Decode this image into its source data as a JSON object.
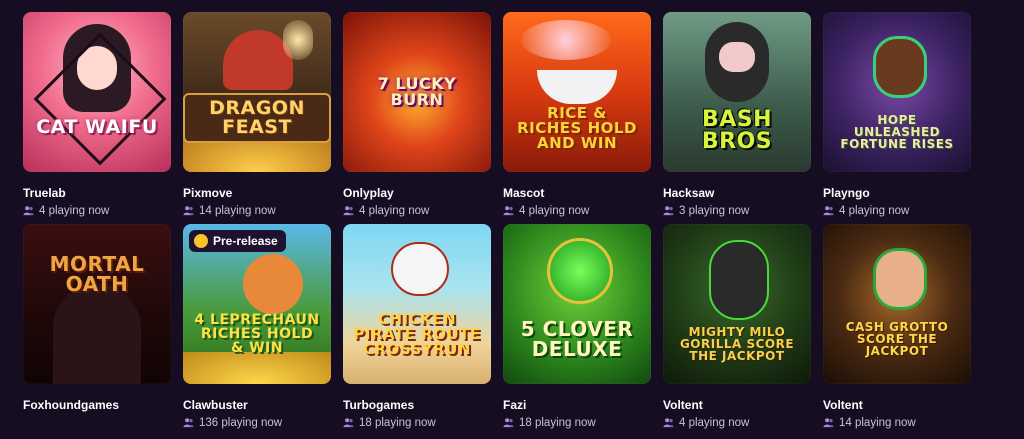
{
  "games": [
    {
      "title_art": "CAT WAIFU",
      "provider": "Truelab",
      "playing": "4 playing now"
    },
    {
      "title_art": "DRAGON FEAST",
      "provider": "Pixmove",
      "playing": "14 playing now"
    },
    {
      "title_art": "7 Lucky BURN",
      "provider": "Onlyplay",
      "playing": "4 playing now"
    },
    {
      "title_art": "RICE & RICHES Hold and Win",
      "provider": "Mascot",
      "playing": "4 playing now"
    },
    {
      "title_art": "BASH BROS",
      "provider": "Hacksaw",
      "playing": "3 playing now"
    },
    {
      "title_art": "HOPE UNLEASHED FORTUNE RISES",
      "provider": "Playngo",
      "playing": "4 playing now"
    },
    {
      "title_art": "MORTAL OATH",
      "provider": "Foxhoundgames",
      "playing": ""
    },
    {
      "title_art": "4 LEPRECHAUN RICHES HOLD & WIN",
      "provider": "Clawbuster",
      "playing": "136 playing now",
      "badge": "Pre-release"
    },
    {
      "title_art": "CHICKEN PIRATE ROUTE CROSSYRUN",
      "provider": "Turbogames",
      "playing": "18 playing now"
    },
    {
      "title_art": "5 CLOVER DELUXE",
      "provider": "Fazi",
      "playing": "18 playing now"
    },
    {
      "title_art": "MIGHTY MILO GORILLA SCORE THE JACKPOT",
      "provider": "Voltent",
      "playing": "4 playing now"
    },
    {
      "title_art": "CASH GROTTO SCORE THE JACKPOT",
      "provider": "Voltent",
      "playing": "14 playing now"
    }
  ],
  "icons": {
    "players": "users-icon",
    "badge": "lightning-bolt-icon"
  },
  "colors": {
    "background": "#170d22",
    "subtext": "#c9c3d6",
    "badge_bolt": "#f6c22a"
  }
}
